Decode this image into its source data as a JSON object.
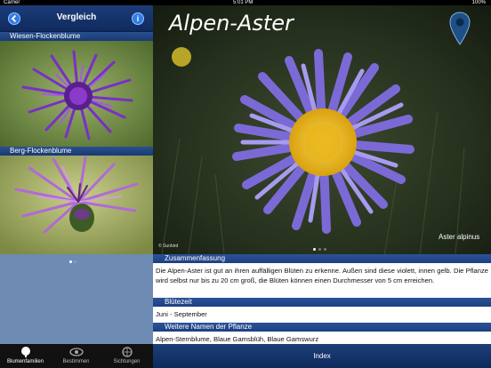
{
  "status_bar": {
    "carrier": "Carrier",
    "time": "5:01 PM",
    "battery": "100%"
  },
  "left_panel": {
    "nav": {
      "title": "Vergleich",
      "back_icon": "back-arrow-icon",
      "info_icon": "info-icon"
    },
    "items": [
      {
        "label": "Wiesen-Flockenblume"
      },
      {
        "label": "Berg-Flockenblume"
      }
    ],
    "page_indicator": {
      "count": 2,
      "active": 1
    }
  },
  "tabbar": {
    "tabs": [
      {
        "label": "Blumenfamilien",
        "icon": "tree-icon",
        "active": true
      },
      {
        "label": "Bestimmen",
        "icon": "eye-icon",
        "active": false
      },
      {
        "label": "Sichtungen",
        "icon": "globe-icon",
        "active": false
      }
    ]
  },
  "detail": {
    "title": "Alpen-Aster",
    "latin_name": "Aster alpinus",
    "copyright": "© Sunbird",
    "map_pin_icon": "map-pin-icon",
    "photo_page_indicator": {
      "count": 3,
      "active": 1
    },
    "sections": [
      {
        "heading": "Zusammenfassung",
        "body": "Die Alpen-Aster ist gut an ihren auffälligen Blüten zu erkenne. Außen sind diese violett, innen gelb. Die Pflanze wird selbst nur bis zu 20 cm groß, die Blüten können einen Durchmesser von 5 cm erreichen."
      },
      {
        "heading": "Blütezeit",
        "body": "Juni - September"
      },
      {
        "heading": "Weitere Namen der Pflanze",
        "body": "Alpen-Sternblume, Blaue Gamsblüh, Blaue Gamswurz"
      }
    ],
    "index_label": "Index"
  },
  "colors": {
    "nav_blue": "#173a73",
    "accent_blue": "#2f7de6",
    "aster_purple": "#8f7be0",
    "center_yellow": "#f2c21b"
  }
}
